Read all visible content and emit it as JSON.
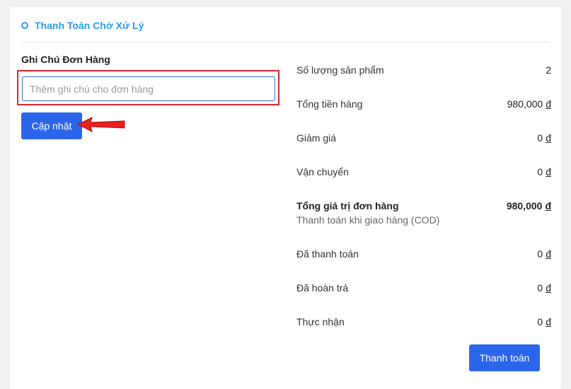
{
  "status": {
    "label": "Thanh Toán Chờ Xử Lý"
  },
  "note": {
    "title": "Ghi Chú Đơn Hàng",
    "placeholder": "Thêm ghi chú cho đơn hàng",
    "value": "",
    "update_label": "Cập nhật"
  },
  "summary": {
    "currency_symbol": "đ",
    "rows": [
      {
        "label": "Số lượng sản phẩm",
        "amount": "2"
      },
      {
        "label": "Tổng tiền hàng",
        "amount": "980,000"
      },
      {
        "label": "Giảm giá",
        "amount": "0"
      },
      {
        "label": "Vận chuyển",
        "amount": "0"
      },
      {
        "label": "Tổng giá trị đơn hàng",
        "amount": "980,000",
        "sub_label": "Thanh toán khi giao hàng (COD)"
      },
      {
        "label": "Đã thanh toán",
        "amount": "0"
      },
      {
        "label": "Đã hoàn trả",
        "amount": "0"
      },
      {
        "label": "Thực nhận",
        "amount": "0"
      }
    ]
  },
  "actions": {
    "pay_label": "Thanh toán"
  },
  "colors": {
    "accent": "#2b65ec",
    "status": "#2a9ee8",
    "highlight": "#d8272d"
  }
}
